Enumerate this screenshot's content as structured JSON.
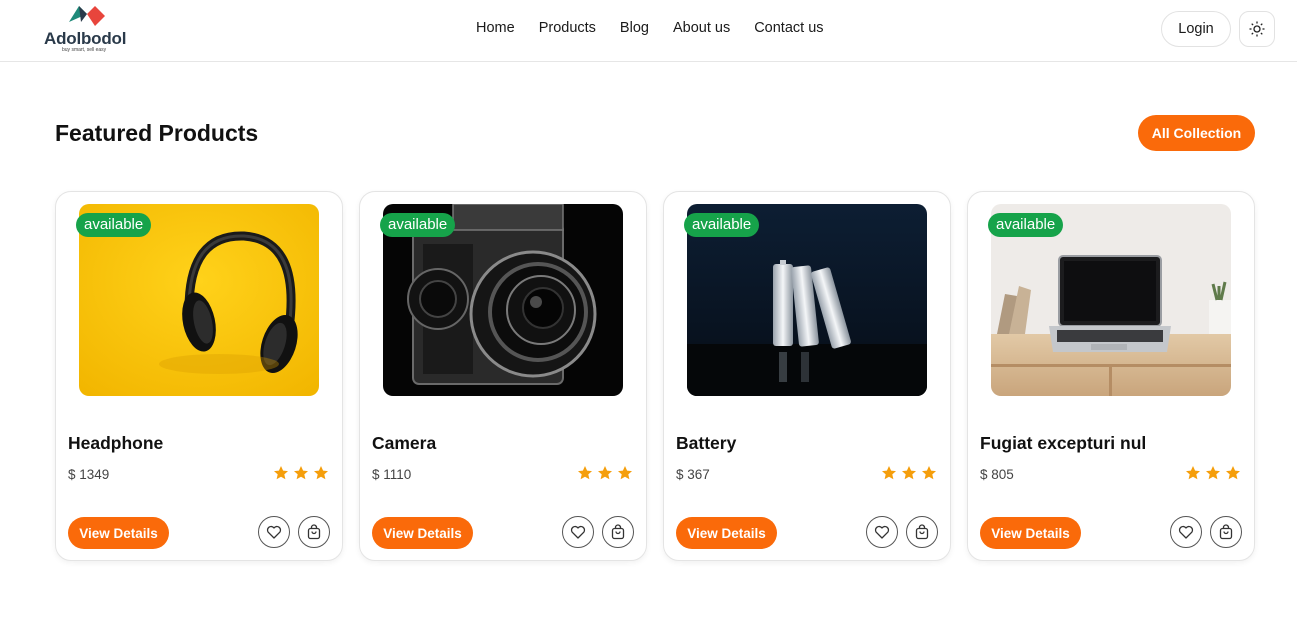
{
  "brand": {
    "name": "Adolbodol",
    "tagline": "buy smart, sell easy"
  },
  "nav": {
    "items": [
      "Home",
      "Products",
      "Blog",
      "About us",
      "Contact us"
    ]
  },
  "header": {
    "login_label": "Login",
    "theme_icon": "sun-icon"
  },
  "section": {
    "title": "Featured Products",
    "all_label": "All Collection"
  },
  "products": [
    {
      "name": "Headphone",
      "price": "$ 1349",
      "badge": "available",
      "rating": 3,
      "details_label": "View Details"
    },
    {
      "name": "Camera",
      "price": "$ 1110",
      "badge": "available",
      "rating": 3,
      "details_label": "View Details"
    },
    {
      "name": "Battery",
      "price": "$ 367",
      "badge": "available",
      "rating": 3,
      "details_label": "View Details"
    },
    {
      "name": "Fugiat excepturi nul",
      "price": "$ 805",
      "badge": "available",
      "rating": 3,
      "details_label": "View Details"
    }
  ],
  "colors": {
    "accent": "#fa6a0a",
    "badge": "#16a34a",
    "star": "#f59e0b"
  }
}
